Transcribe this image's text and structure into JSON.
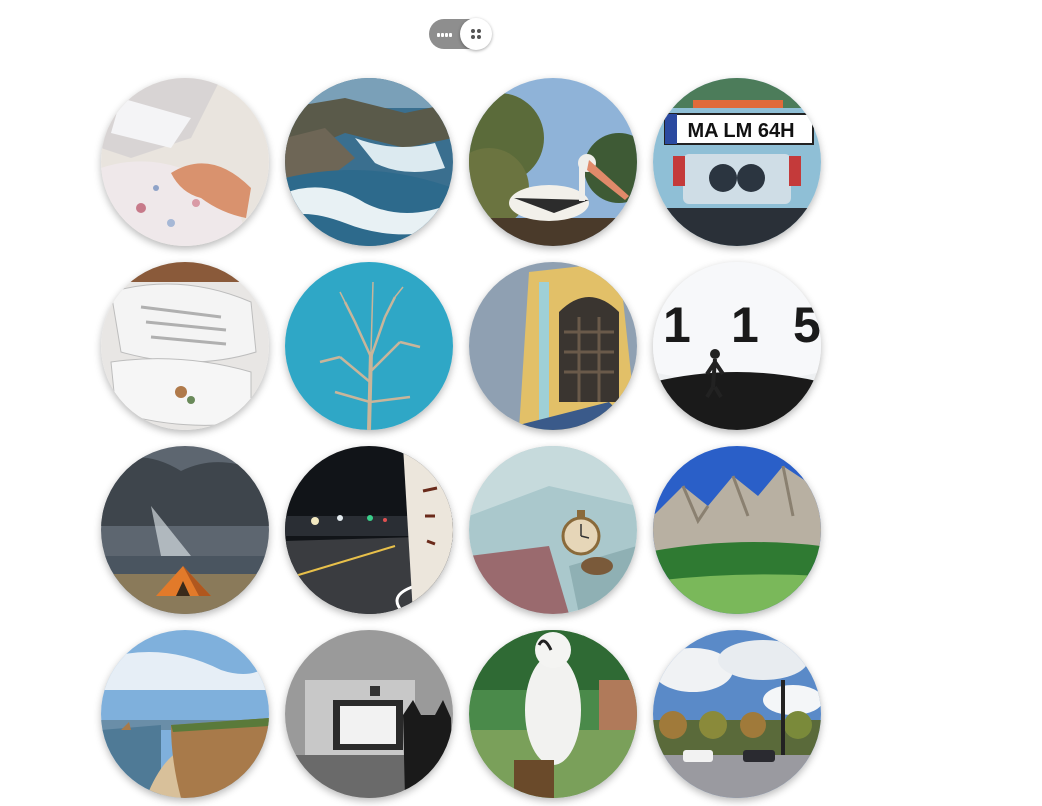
{
  "view_toggle": {
    "left_icon": "list-view-icon",
    "right_icon": "grid-view-icon",
    "active": "grid"
  },
  "gallery": {
    "photos": [
      {
        "id": "hands-baby-blanket",
        "scene": "hands-baby"
      },
      {
        "id": "rocky-coast-waves",
        "scene": "rocky-coast"
      },
      {
        "id": "pelican-tree",
        "scene": "pelican"
      },
      {
        "id": "car-license-plate",
        "scene": "license-plate",
        "plate_text": "MA LM 64H"
      },
      {
        "id": "white-sneakers",
        "scene": "sneakers"
      },
      {
        "id": "bare-tree-blue-sky",
        "scene": "bare-tree"
      },
      {
        "id": "yellow-bell-tower",
        "scene": "tower"
      },
      {
        "id": "person-digital-clock",
        "scene": "clock-wall",
        "digits": "1 1 5"
      },
      {
        "id": "tent-under-clouds",
        "scene": "tent"
      },
      {
        "id": "night-road-signs",
        "scene": "night-road"
      },
      {
        "id": "pocket-watch-fabric",
        "scene": "pocket-watch"
      },
      {
        "id": "mountain-cliffs",
        "scene": "mountains"
      },
      {
        "id": "coastal-cliffs-beach",
        "scene": "coast-cliffs"
      },
      {
        "id": "cat-old-tv-bw",
        "scene": "cat-tv"
      },
      {
        "id": "white-cockatoo",
        "scene": "cockatoo"
      },
      {
        "id": "street-lamps-cars",
        "scene": "street"
      }
    ]
  }
}
